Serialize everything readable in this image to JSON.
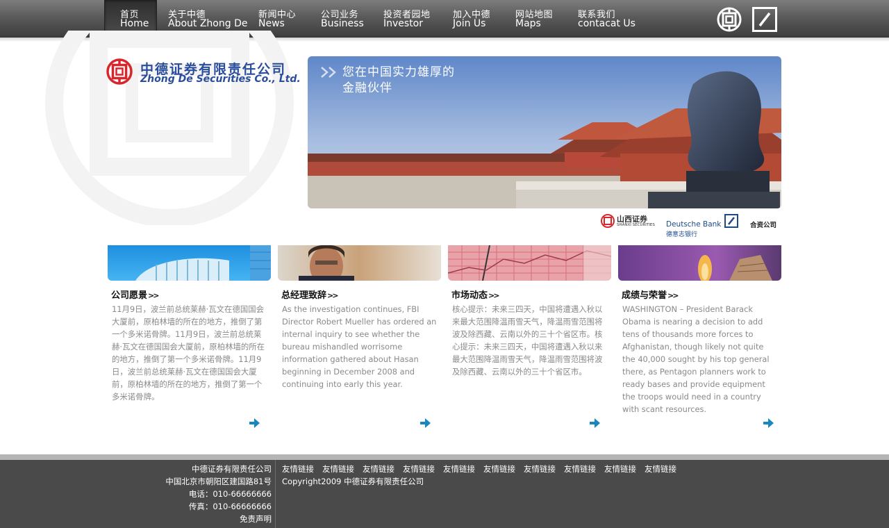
{
  "nav": {
    "items": [
      {
        "zh": "首页",
        "en": "Home"
      },
      {
        "zh": "关于中德",
        "en": "About Zhong De"
      },
      {
        "zh": "新闻中心",
        "en": "News"
      },
      {
        "zh": "公司业务",
        "en": "Business"
      },
      {
        "zh": "投资者园地",
        "en": "Investor"
      },
      {
        "zh": "加入中德",
        "en": "Join Us"
      },
      {
        "zh": "网站地图",
        "en": "Maps"
      },
      {
        "zh": "联系我们",
        "en": "contacat Us"
      }
    ],
    "active_index": 0,
    "icons": [
      "zhongde-emblem-icon",
      "deutsche-bank-icon"
    ]
  },
  "logo": {
    "zh": "中德证券有限责任公司",
    "en": "Zhong De Securities Co., Ltd."
  },
  "banner": {
    "line1": "您在中国实力雄厚的",
    "line2": "金融伙伴"
  },
  "partners": {
    "shanxi_zh": "山西证券",
    "shanxi_en": "SHANXI SECURITIES",
    "db_en": "Deutsche Bank",
    "db_zh": "德意志银行",
    "jv": "合资公司"
  },
  "columns": [
    {
      "title": "公司愿景",
      "body": "11月9日，波兰前总统莱赫·瓦文在德国国会大厦前，原柏林墙的所在的地方，推倒了第一个多米诺骨牌。11月9日，波兰前总统莱赫·瓦文在德国国会大厦前，原柏林墙的所在的地方，推倒了第一个多米诺骨牌。11月9日，波兰前总统莱赫·瓦文在德国国会大厦前，原柏林墙的所在的地方，推倒了第一个多米诺骨牌。"
    },
    {
      "title": "总经理致辞",
      "body": "As the investigation continues, FBI Director Robert Mueller has ordered an internal inquiry to see whether the bureau mishandled worrisome information gathered about Hasan beginning in December 2008 and continuing into early this year."
    },
    {
      "title": "市场动态",
      "body": "核心提示：未来三四天，中国将遭遇入秋以来最大范围降温雨雪天气，降温雨雪范围将波及除西藏、云南以外的三十个省区市。核心提示：未来三四天，中国将遭遇入秋以来最大范围降温雨雪天气，降温雨雪范围将波及除西藏、云南以外的三十个省区市。"
    },
    {
      "title": "成绩与荣誉",
      "body": "WASHINGTON – President Barack Obama is nearing a decision to add tens of thousands more forces to Afghanistan, though likely not quite the 40,000 sought by his top general there, as Pentagon planners work to ready bases and provide equipment the troops would need in a country with scant resources."
    }
  ],
  "footer": {
    "company": "中德证券有限责任公司",
    "address": "中国北京市朝阳区建国路81号",
    "phone": "电话：010-66666666",
    "fax": "传真：010-66666666",
    "disclaimer": "免责声明",
    "links": [
      "友情链接",
      "友情链接",
      "友情链接",
      "友情链接",
      "友情链接",
      "友情链接",
      "友情链接",
      "友情链接",
      "友情链接",
      "友情链接"
    ],
    "copyright": "Copyright2009 中德证券有限责任公司"
  },
  "colors": {
    "brand_red": "#d9262c",
    "brand_blue": "#2a4d9c",
    "accent_arrow": "#1a86c0",
    "footer_bg": "#4a4a4a"
  }
}
